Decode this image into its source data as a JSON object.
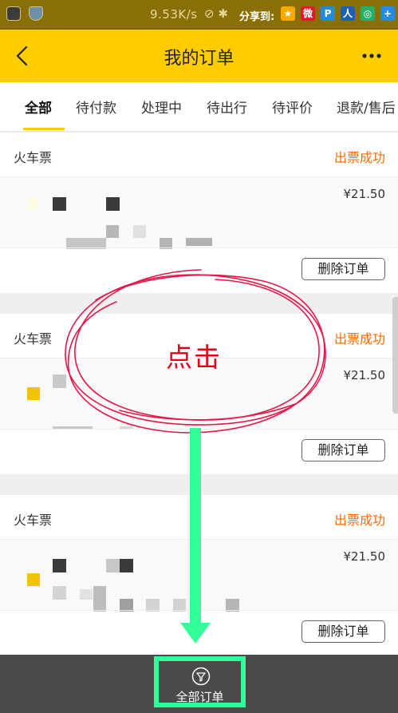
{
  "statusbar": {
    "speed": "9.53K/s",
    "share_label": "分享到:",
    "share_icons": [
      {
        "icon": "star-share-icon",
        "glyph": "★",
        "color": "#f6a900"
      },
      {
        "icon": "weibo-share-icon",
        "glyph": "微",
        "color": "#e6162d"
      },
      {
        "icon": "p-share-icon",
        "glyph": "P",
        "color": "#1f8bd9"
      },
      {
        "icon": "renren-share-icon",
        "glyph": "人",
        "color": "#1d5fb0"
      },
      {
        "icon": "wechat-share-icon",
        "glyph": "◎",
        "color": "#2aae67"
      },
      {
        "icon": "plus-share-icon",
        "glyph": "+",
        "color": "#2789e6"
      }
    ]
  },
  "header": {
    "title": "我的订单"
  },
  "tabs": [
    {
      "label": "全部",
      "active": true
    },
    {
      "label": "待付款",
      "active": false
    },
    {
      "label": "处理中",
      "active": false
    },
    {
      "label": "待出行",
      "active": false
    },
    {
      "label": "待评价",
      "active": false
    },
    {
      "label": "退款/售后",
      "active": false
    }
  ],
  "orders": [
    {
      "type": "火车票",
      "status": "出票成功",
      "price": "¥21.50",
      "action": "删除订单"
    },
    {
      "type": "火车票",
      "status": "出票成功",
      "price": "¥21.50",
      "action": "删除订单"
    },
    {
      "type": "火车票",
      "status": "出票成功",
      "price": "¥21.50",
      "action": "删除订单"
    }
  ],
  "annotation": {
    "text": "点击"
  },
  "bottombar": {
    "all_orders_label": "全部订单"
  },
  "colors": {
    "brand_yellow": "#ffcc00",
    "status_orange": "#ff6a00",
    "annotation_red": "#e2001a",
    "highlight_green": "#33ff9a"
  }
}
